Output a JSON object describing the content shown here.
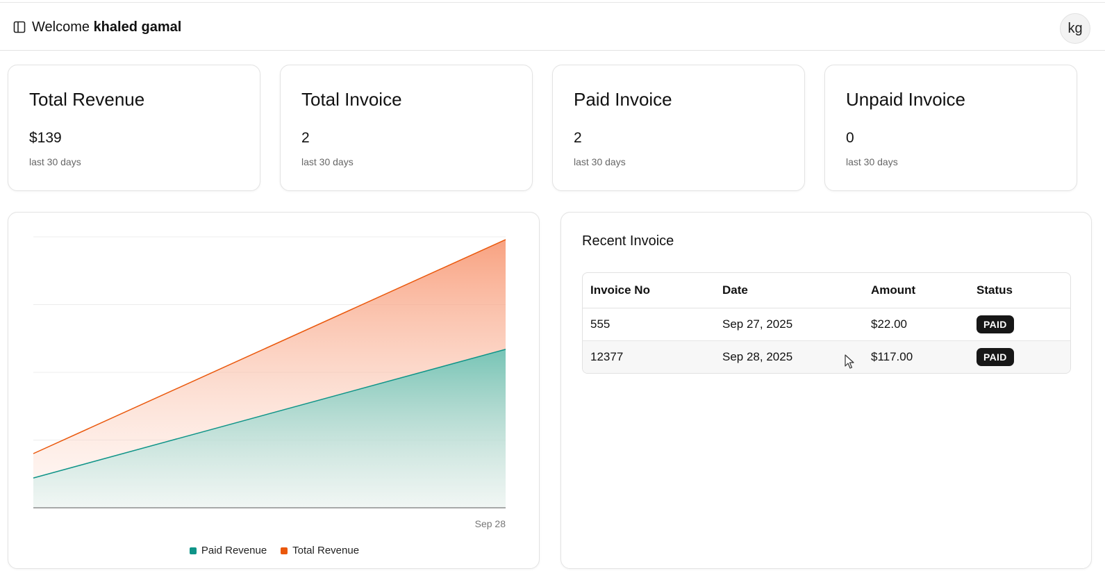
{
  "header": {
    "welcome_prefix": "Welcome",
    "user_name": "khaled gamal",
    "avatar_initials": "kg",
    "toggle_icon": "sidebar-toggle-icon"
  },
  "stats": [
    {
      "title": "Total Revenue",
      "value": "$139",
      "sub": "last 30 days"
    },
    {
      "title": "Total Invoice",
      "value": "2",
      "sub": "last 30 days"
    },
    {
      "title": "Paid Invoice",
      "value": "2",
      "sub": "last 30 days"
    },
    {
      "title": "Unpaid Invoice",
      "value": "0",
      "sub": "last 30 days"
    }
  ],
  "chart_data": {
    "type": "area",
    "x_tick_label": "Sep 28",
    "series": [
      {
        "name": "Paid Revenue",
        "color": "#0f9488",
        "values": [
          22,
          117
        ]
      },
      {
        "name": "Total Revenue",
        "color": "#ea580c",
        "values": [
          40,
          198
        ]
      }
    ],
    "ylim": [
      0,
      200
    ],
    "grid": true
  },
  "recent_invoice": {
    "title": "Recent Invoice",
    "columns": [
      "Invoice No",
      "Date",
      "Amount",
      "Status"
    ],
    "rows": [
      {
        "invoice_no": "555",
        "date": "Sep 27, 2025",
        "amount": "$22.00",
        "status": "PAID"
      },
      {
        "invoice_no": "12377",
        "date": "Sep 28, 2025",
        "amount": "$117.00",
        "status": "PAID"
      }
    ]
  }
}
